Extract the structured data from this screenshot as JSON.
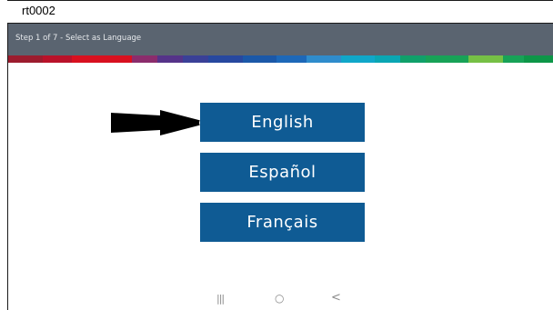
{
  "window": {
    "title": "rt0002"
  },
  "header": {
    "step_text": "Step 1 of 7 - Select as Language"
  },
  "brand_stripe": {
    "colors": [
      "#9c1c2e",
      "#b9122a",
      "#d8101f",
      "#8b2c6c",
      "#553389",
      "#3a4097",
      "#27489f",
      "#1b58a8",
      "#1d68b8",
      "#2f8ccc",
      "#10a7c9",
      "#0aa6b3",
      "#10a06a",
      "#18a257",
      "#76c045",
      "#18a257",
      "#0d9648"
    ]
  },
  "languages": [
    {
      "label": "English"
    },
    {
      "label": "Español"
    },
    {
      "label": "Français"
    }
  ],
  "colors": {
    "button_bg": "#0f5b94",
    "header_bg": "#5a6470"
  },
  "pointer_arrow": "right-arrow",
  "nav_bar": {
    "recents_icon": "|||",
    "home_icon": "○",
    "back_icon": "<"
  }
}
